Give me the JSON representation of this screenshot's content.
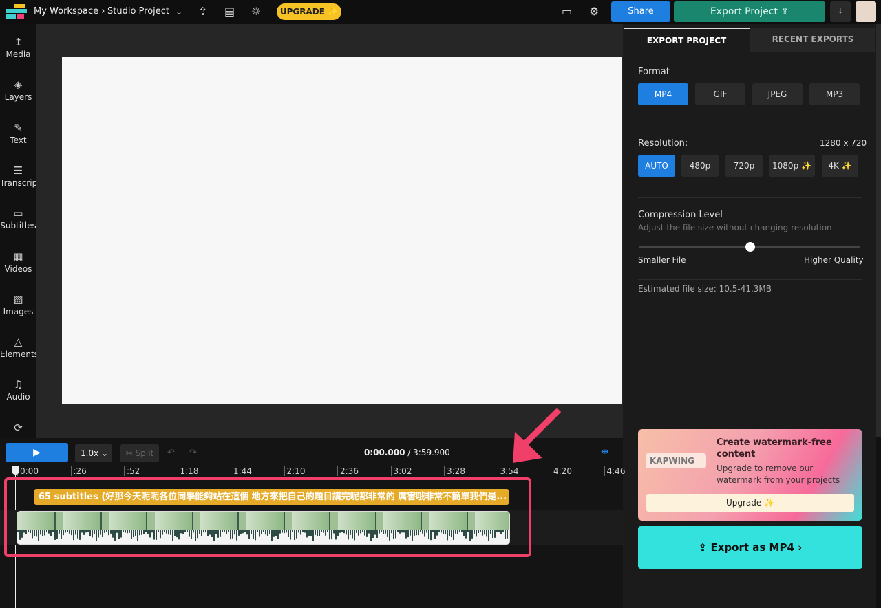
{
  "topbar": {
    "breadcrumb_workspace": "My Workspace ›",
    "project": "Studio Project",
    "upgrade": "UPGRADE ✨",
    "share": "Share",
    "export_project": "Export Project ⇪",
    "icons": [
      "kapwing-logo",
      "chevron-down-icon",
      "upload-icon",
      "subtitles-icon",
      "lightbulb-icon",
      "comment-icon",
      "gear-icon",
      "download-icon"
    ]
  },
  "sidebar": {
    "items": [
      {
        "label": "Media",
        "icon": "↥"
      },
      {
        "label": "Layers",
        "icon": "◈"
      },
      {
        "label": "Text",
        "icon": "✎"
      },
      {
        "label": "Transcript",
        "icon": "☰"
      },
      {
        "label": "Subtitles",
        "icon": "▭"
      },
      {
        "label": "Videos",
        "icon": "▦"
      },
      {
        "label": "Images",
        "icon": "▨"
      },
      {
        "label": "Elements",
        "icon": "△"
      },
      {
        "label": "Audio",
        "icon": "♫"
      },
      {
        "label": "",
        "icon": "⟳"
      }
    ]
  },
  "panel": {
    "tabs": [
      "EXPORT PROJECT",
      "RECENT EXPORTS"
    ],
    "format_label": "Format",
    "formats": [
      "MP4",
      "GIF",
      "JPEG",
      "MP3"
    ],
    "format_selected": "MP4",
    "resolution_label": "Resolution:",
    "resolution_value": "1280 x 720",
    "resolutions": [
      "AUTO",
      "480p",
      "720p",
      "1080p ✨",
      "4K ✨"
    ],
    "resolution_selected": "AUTO",
    "compression_label": "Compression Level",
    "compression_desc": "Adjust the file size without changing resolution",
    "compression_level": 0.5,
    "slider_min": "Smaller File",
    "slider_max": "Higher Quality",
    "estimate": "Estimated file size: 10.5-41.3MB",
    "promo": {
      "logo": "KAPWING",
      "title": "Create watermark-free content",
      "desc": "Upgrade to remove our watermark from your projects",
      "button": "Upgrade ✨"
    },
    "export_button": "Export as MP4"
  },
  "timeline": {
    "speed": "1.0x",
    "split": "✂ Split",
    "current": "0:00.000",
    "total": " / 3:59.900",
    "ticks": [
      "0:00",
      ":26",
      ":52",
      "1:18",
      "1:44",
      "2:10",
      "2:36",
      "3:02",
      "3:28",
      "3:54",
      "4:20",
      "4:46"
    ],
    "subtitle_track": "65 subtitles (好那今天呢呃各位同學能夠站在這個 地方來把自己的題目講完呢都非常的 厲害哦非常不簡單我們是..."
  },
  "colors": {
    "accent": "#1f7fe0",
    "highlight": "#f0406a",
    "subtitle": "#e5aa27",
    "export": "#33e2dc"
  }
}
